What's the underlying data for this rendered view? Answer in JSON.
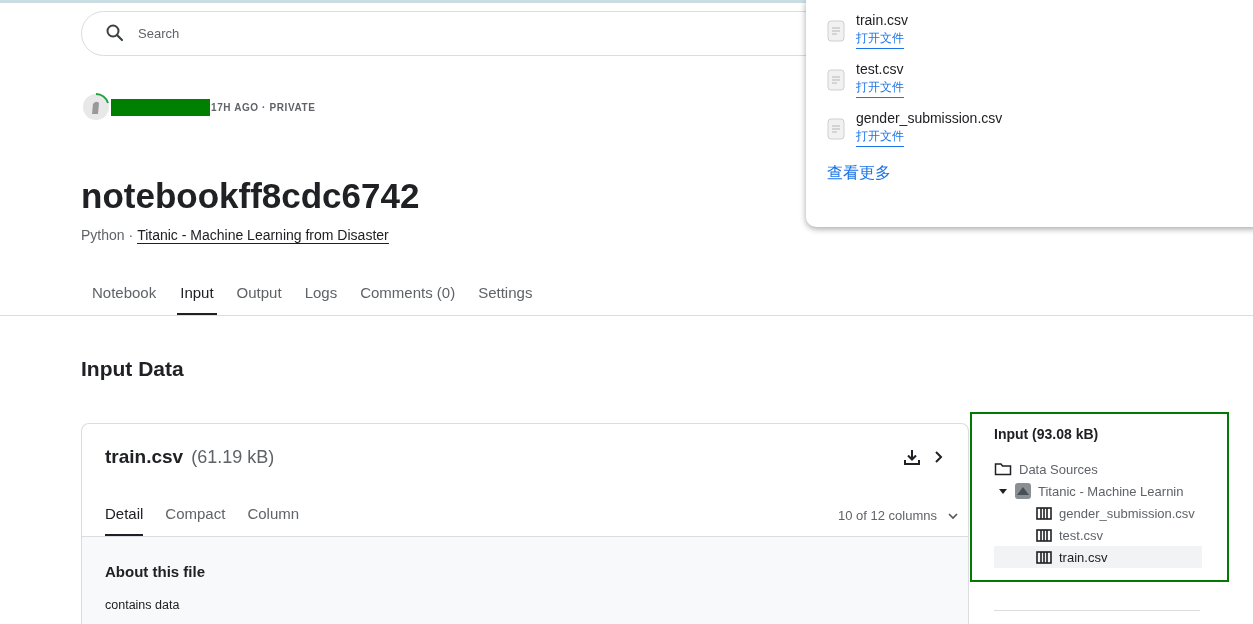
{
  "search": {
    "placeholder": "Search"
  },
  "author": {
    "meta": "17H AGO · PRIVATE"
  },
  "title": "notebookff8cdc6742",
  "subtitle": {
    "language": "Python ·",
    "competition": "Titanic - Machine Learning from Disaster"
  },
  "tabs": [
    {
      "label": "Notebook",
      "selected": false
    },
    {
      "label": "Input",
      "selected": true
    },
    {
      "label": "Output",
      "selected": false
    },
    {
      "label": "Logs",
      "selected": false
    },
    {
      "label": "Comments (0)",
      "selected": false
    },
    {
      "label": "Settings",
      "selected": false
    }
  ],
  "section_title": "Input Data",
  "file_card": {
    "name": "train.csv",
    "size": "(61.19 kB)",
    "tabs": [
      {
        "label": "Detail",
        "selected": true
      },
      {
        "label": "Compact",
        "selected": false
      },
      {
        "label": "Column",
        "selected": false
      }
    ],
    "columns_toggle": "10 of 12 columns",
    "about_title": "About this file",
    "description": "contains data"
  },
  "input_panel": {
    "title": "Input (93.08 kB)",
    "tree": [
      {
        "label": "Data Sources",
        "kind": "folder",
        "children": [
          {
            "label": "Titanic - Machine Learnin",
            "kind": "dataset",
            "expanded": true,
            "children": [
              {
                "label": "gender_submission.csv",
                "kind": "file",
                "selected": false
              },
              {
                "label": "test.csv",
                "kind": "file",
                "selected": false
              },
              {
                "label": "train.csv",
                "kind": "file",
                "selected": true
              }
            ]
          }
        ]
      }
    ]
  },
  "downloads_popup": {
    "files": [
      {
        "name": "train.csv",
        "action": "打开文件"
      },
      {
        "name": "test.csv",
        "action": "打开文件"
      },
      {
        "name": "gender_submission.csv",
        "action": "打开文件"
      }
    ],
    "more": "查看更多"
  }
}
